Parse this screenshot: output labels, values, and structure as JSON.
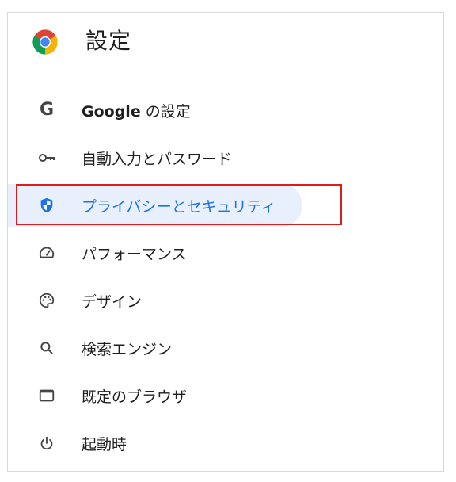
{
  "header": {
    "title": "設定",
    "logo_icon": "chrome-logo-icon"
  },
  "colors": {
    "active_text": "#1a73e8",
    "active_bg": "#e8effd",
    "highlight_border": "#e01b1b",
    "text": "#1f1f1f",
    "icon": "#444444"
  },
  "nav": {
    "items": [
      {
        "id": "google",
        "icon": "google-g-icon",
        "label_brand": "Google",
        "label_rest": " の設定",
        "active": false
      },
      {
        "id": "autofill",
        "icon": "key-icon",
        "label": "自動入力とパスワード",
        "active": false
      },
      {
        "id": "privacy",
        "icon": "shield-icon",
        "label": "プライバシーとセキュリティ",
        "active": true
      },
      {
        "id": "performance",
        "icon": "speedometer-icon",
        "label": "パフォーマンス",
        "active": false
      },
      {
        "id": "appearance",
        "icon": "palette-icon",
        "label": "デザイン",
        "active": false
      },
      {
        "id": "search",
        "icon": "search-icon",
        "label": "検索エンジン",
        "active": false
      },
      {
        "id": "default-browser",
        "icon": "browser-window-icon",
        "label": "既定のブラウザ",
        "active": false
      },
      {
        "id": "startup",
        "icon": "power-icon",
        "label": "起動時",
        "active": false
      }
    ]
  }
}
